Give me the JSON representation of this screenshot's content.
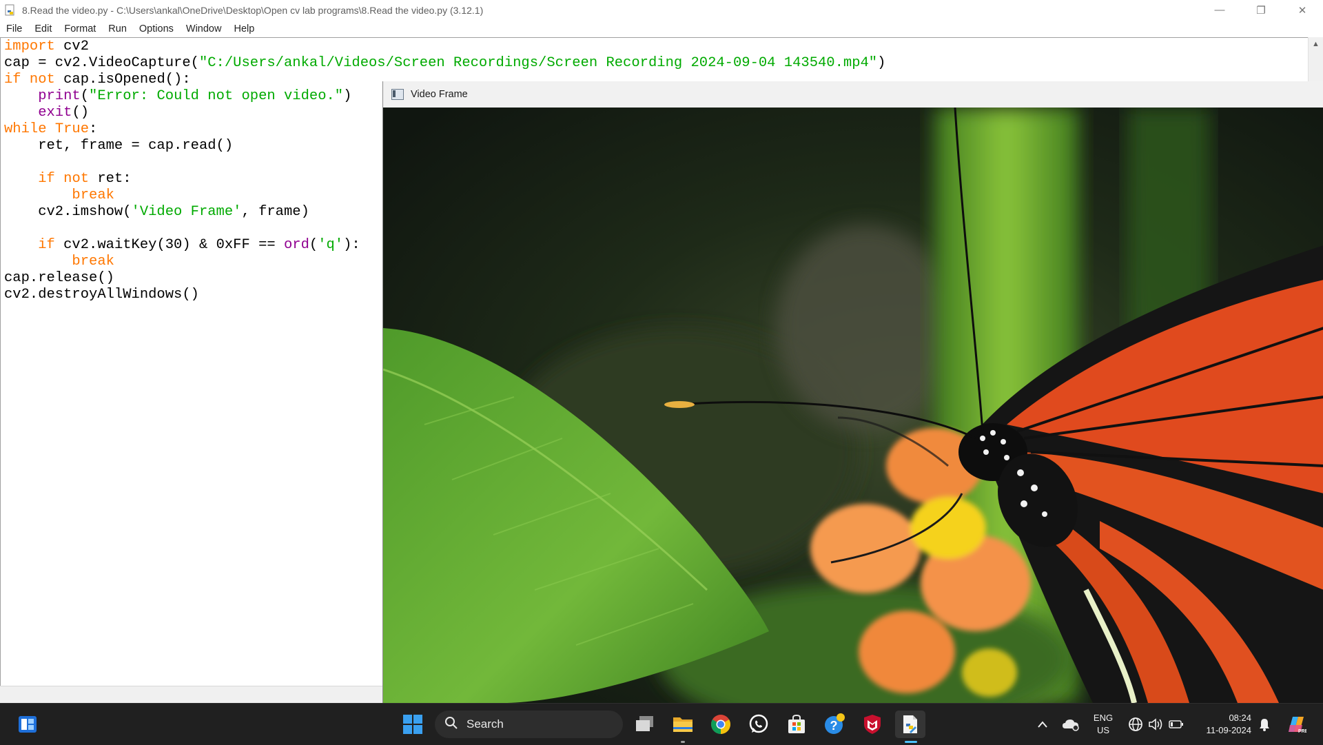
{
  "idle": {
    "title": "8.Read the video.py - C:\\Users\\ankal\\OneDrive\\Desktop\\Open cv lab programs\\8.Read the video.py (3.12.1)",
    "menu": [
      "File",
      "Edit",
      "Format",
      "Run",
      "Options",
      "Window",
      "Help"
    ],
    "code_lines": [
      [
        {
          "t": "import",
          "c": "kw"
        },
        {
          "t": " cv2",
          "c": ""
        }
      ],
      [
        {
          "t": "cap = cv2.VideoCapture(",
          "c": ""
        },
        {
          "t": "\"C:/Users/ankal/Videos/Screen Recordings/Screen Recording 2024-09-04 143540.mp4\"",
          "c": "str"
        },
        {
          "t": ")",
          "c": ""
        }
      ],
      [
        {
          "t": "if",
          "c": "kw"
        },
        {
          "t": " ",
          "c": ""
        },
        {
          "t": "not",
          "c": "kw"
        },
        {
          "t": " cap.isOpened():",
          "c": ""
        }
      ],
      [
        {
          "t": "    ",
          "c": ""
        },
        {
          "t": "print",
          "c": "bi"
        },
        {
          "t": "(",
          "c": ""
        },
        {
          "t": "\"Error: Could not open video.\"",
          "c": "str"
        },
        {
          "t": ")",
          "c": ""
        }
      ],
      [
        {
          "t": "    ",
          "c": ""
        },
        {
          "t": "exit",
          "c": "bi"
        },
        {
          "t": "()",
          "c": ""
        }
      ],
      [
        {
          "t": "while",
          "c": "kw"
        },
        {
          "t": " ",
          "c": ""
        },
        {
          "t": "True",
          "c": "kw"
        },
        {
          "t": ":",
          "c": ""
        }
      ],
      [
        {
          "t": "    ret, frame = cap.read()",
          "c": ""
        }
      ],
      [
        {
          "t": "",
          "c": ""
        }
      ],
      [
        {
          "t": "    ",
          "c": ""
        },
        {
          "t": "if",
          "c": "kw"
        },
        {
          "t": " ",
          "c": ""
        },
        {
          "t": "not",
          "c": "kw"
        },
        {
          "t": " ret:",
          "c": ""
        }
      ],
      [
        {
          "t": "        ",
          "c": ""
        },
        {
          "t": "break",
          "c": "kw"
        }
      ],
      [
        {
          "t": "    cv2.imshow(",
          "c": ""
        },
        {
          "t": "'Video Frame'",
          "c": "str"
        },
        {
          "t": ", frame)",
          "c": ""
        }
      ],
      [
        {
          "t": "",
          "c": ""
        }
      ],
      [
        {
          "t": "    ",
          "c": ""
        },
        {
          "t": "if",
          "c": "kw"
        },
        {
          "t": " cv2.waitKey(30) & 0xFF == ",
          "c": ""
        },
        {
          "t": "ord",
          "c": "bi"
        },
        {
          "t": "(",
          "c": ""
        },
        {
          "t": "'q'",
          "c": "str"
        },
        {
          "t": "):",
          "c": ""
        }
      ],
      [
        {
          "t": "        ",
          "c": ""
        },
        {
          "t": "break",
          "c": "kw"
        }
      ],
      [
        {
          "t": "cap.release()",
          "c": ""
        }
      ],
      [
        {
          "t": "cv2.destroyAllWindows()",
          "c": ""
        }
      ]
    ]
  },
  "video_window": {
    "title": "Video Frame"
  },
  "taskbar": {
    "search_placeholder": "Search",
    "pinned_icons": [
      "start-icon",
      "task-view-icon",
      "file-explorer-icon",
      "chrome-icon",
      "whatsapp-icon",
      "microsoft-store-icon",
      "get-help-icon",
      "mcafee-icon",
      "python-idle-icon"
    ],
    "tray": {
      "language_top": "ENG",
      "language_bottom": "US",
      "time": "08:24",
      "date": "11-09-2024"
    }
  },
  "colors": {
    "keyword": "#ff7700",
    "builtin": "#900090",
    "string": "#00aa00",
    "taskbar": "#202020",
    "accent": "#4cc2ff"
  }
}
